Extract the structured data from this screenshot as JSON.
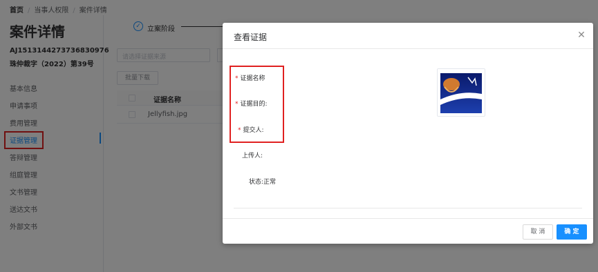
{
  "breadcrumb": [
    "首页",
    "当事人权限",
    "案件详情"
  ],
  "page_title": "案件详情",
  "case": {
    "number": "AJ1513144273736830976",
    "doc_no": "珠仲裁字（2022）第39号"
  },
  "sidebar": {
    "items": [
      {
        "label": "基本信息"
      },
      {
        "label": "申请事项"
      },
      {
        "label": "费用管理"
      },
      {
        "label": "证据管理",
        "active": true
      },
      {
        "label": "答辩管理"
      },
      {
        "label": "组庭管理"
      },
      {
        "label": "文书管理"
      },
      {
        "label": "送达文书"
      },
      {
        "label": "外部文书"
      }
    ]
  },
  "steps": {
    "current_label": "立案阶段",
    "current_icon": "check-icon"
  },
  "filter": {
    "source_placeholder": "请选择证据来源"
  },
  "toolbar": {
    "batch_download": "批量下载"
  },
  "table": {
    "columns": [
      "证据名称"
    ],
    "rows": [
      {
        "name": "Jellyfish.jpg"
      }
    ]
  },
  "modal": {
    "title": "查看证据",
    "fields": [
      {
        "label": "证据名称",
        "required": true,
        "value": ""
      },
      {
        "label": "证据目的:",
        "required": true,
        "value": ""
      },
      {
        "label": "提交人:",
        "required": true,
        "value": ""
      },
      {
        "label": "上传人:",
        "required": false,
        "value": ""
      },
      {
        "label": "状态:",
        "required": false,
        "value": "正常"
      }
    ],
    "thumbnail_alt": "Jellyfish.jpg",
    "cancel_label": "取 消",
    "ok_label": "确 定"
  },
  "colors": {
    "primary": "#1890ff",
    "required": "#e02020",
    "highlight_box": "#e02020"
  }
}
